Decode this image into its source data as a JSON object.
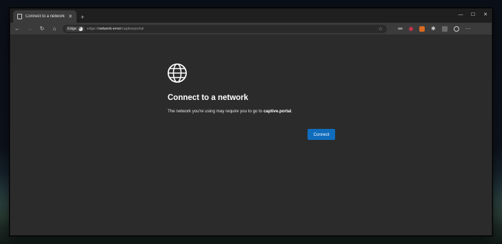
{
  "tab": {
    "title": "Connect to a network",
    "close_glyph": "✕",
    "new_tab_glyph": "+"
  },
  "window_controls": {
    "minimize": "—",
    "maximize": "☐",
    "close": "✕"
  },
  "toolbar": {
    "back": "←",
    "forward": "→",
    "refresh": "↻",
    "home": "⌂",
    "site_chip": "Edge",
    "url_prefix": "edge://",
    "url_host": "network-error",
    "url_path": "/captiveportal",
    "favorite_glyph": "☆",
    "more_glyph": "···"
  },
  "extensions": {
    "puzzle_glyph": "✱"
  },
  "icons": {
    "tab": "page-icon",
    "globe": "globe-icon",
    "edge_logo": "edge-logo-icon",
    "profile": "profile-icon"
  },
  "colors": {
    "accent": "#0f6cbd",
    "background": "#2b2b2b",
    "text": "#ffffff"
  },
  "content": {
    "heading": "Connect to a network",
    "message_prefix": "The network you're using may require you to go to ",
    "message_link": "captive.portal",
    "message_suffix": ".",
    "connect_button": "Connect"
  }
}
